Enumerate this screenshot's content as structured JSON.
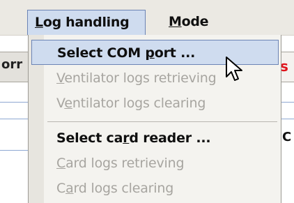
{
  "menubar": {
    "menus": [
      {
        "label": "Log handling",
        "mnemonic_index": 0,
        "open": true
      },
      {
        "label": "Mode",
        "mnemonic_index": 0,
        "open": false
      }
    ]
  },
  "background": {
    "left_tab_text": "orr",
    "right_tab_text": "s",
    "right_lower_text": "C"
  },
  "dropdown": {
    "items": [
      {
        "label_pre": "Select COM ",
        "label_mn": "p",
        "label_post": "ort ...",
        "enabled": true,
        "highlighted": true
      },
      {
        "label_pre": "",
        "label_mn": "V",
        "label_post": "entilator logs retrieving",
        "enabled": false
      },
      {
        "label_pre": "V",
        "label_mn": "e",
        "label_post": "ntilator logs clearing",
        "enabled": false
      },
      {
        "label_pre": "Select ca",
        "label_mn": "r",
        "label_post": "d reader ...",
        "enabled": true
      },
      {
        "label_pre": "",
        "label_mn": "C",
        "label_post": "ard logs retrieving",
        "enabled": false
      },
      {
        "label_pre": "C",
        "label_mn": "a",
        "label_post": "rd logs clearing",
        "enabled": false
      }
    ]
  },
  "colors": {
    "highlight_fill": "#cfdcef",
    "highlight_border": "#6b84b5",
    "disabled_text": "#a7a5a0",
    "menubar_bg": "#ebe9e3",
    "accent_red": "#e0141c"
  },
  "cursor": {
    "icon": "arrow-pointer-icon"
  }
}
